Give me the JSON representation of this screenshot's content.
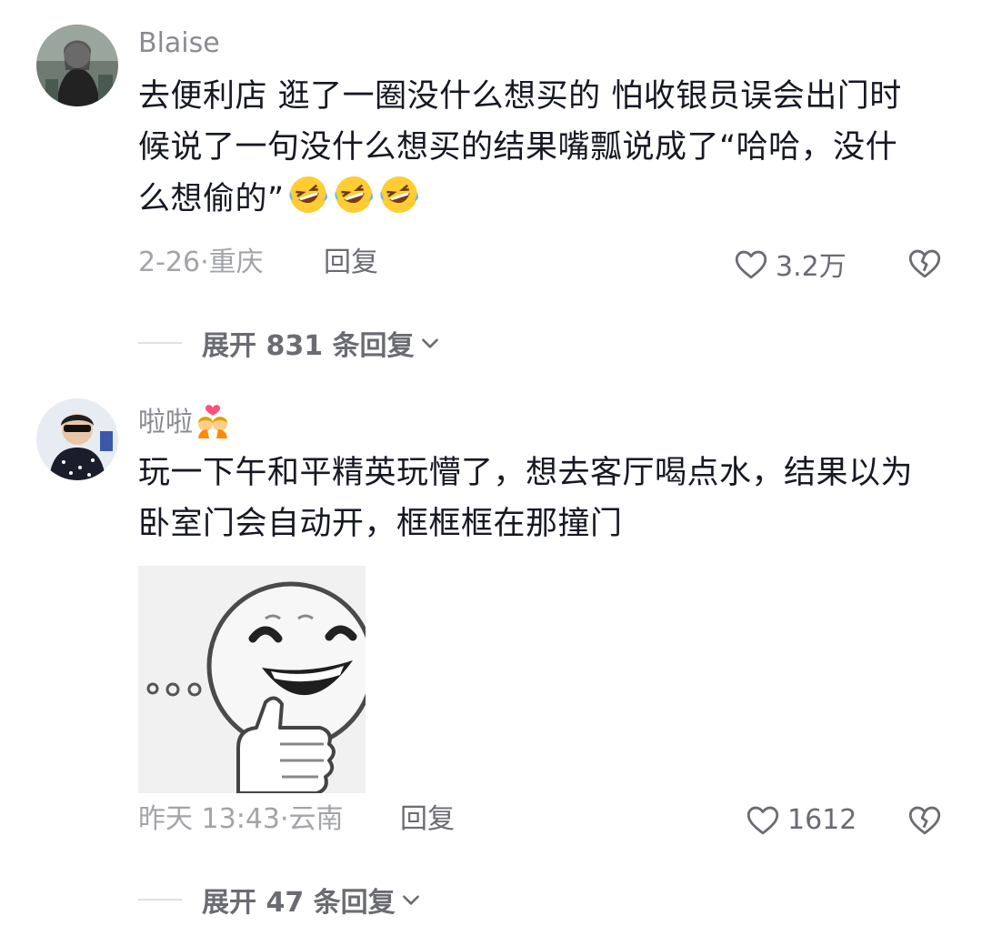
{
  "comments": [
    {
      "username": "Blaise",
      "text_lines": [
        "去便利店 逛了一圈没什么想买的 怕收银员误会出门时",
        "候说了一句没什么想买的结果嘴瓢说成了“哈哈，没什",
        "么想偷的”"
      ],
      "emojis": [
        "rofl-emoji",
        "rofl-emoji",
        "rofl-emoji"
      ],
      "date": "2-26",
      "location": "重庆",
      "meta_sep": "·",
      "reply_label": "回复",
      "likes": "3.2万",
      "expand_label": "展开 831 条回复"
    },
    {
      "username": "啦啦",
      "username_emoji": "kissing-couple-emoji",
      "text_lines": [
        "玩一下午和平精英玩懵了，想去客厅喝点水，结果以为",
        "卧室门会自动开，框框框在那撞门"
      ],
      "sticker": "laughing-thumbs-up-sticker",
      "date": "昨天 13:43",
      "location": "云南",
      "meta_sep": "·",
      "reply_label": "回复",
      "likes": "1612",
      "expand_label": "展开 47 条回复"
    }
  ],
  "icons": {
    "like": "heart-outline-icon",
    "dislike": "broken-heart-icon",
    "expand": "chevron-down-icon"
  },
  "colors": {
    "text": "#161823",
    "secondary": "#8a8b91",
    "muted": "#a3a4a8",
    "action": "#6b6c72"
  }
}
